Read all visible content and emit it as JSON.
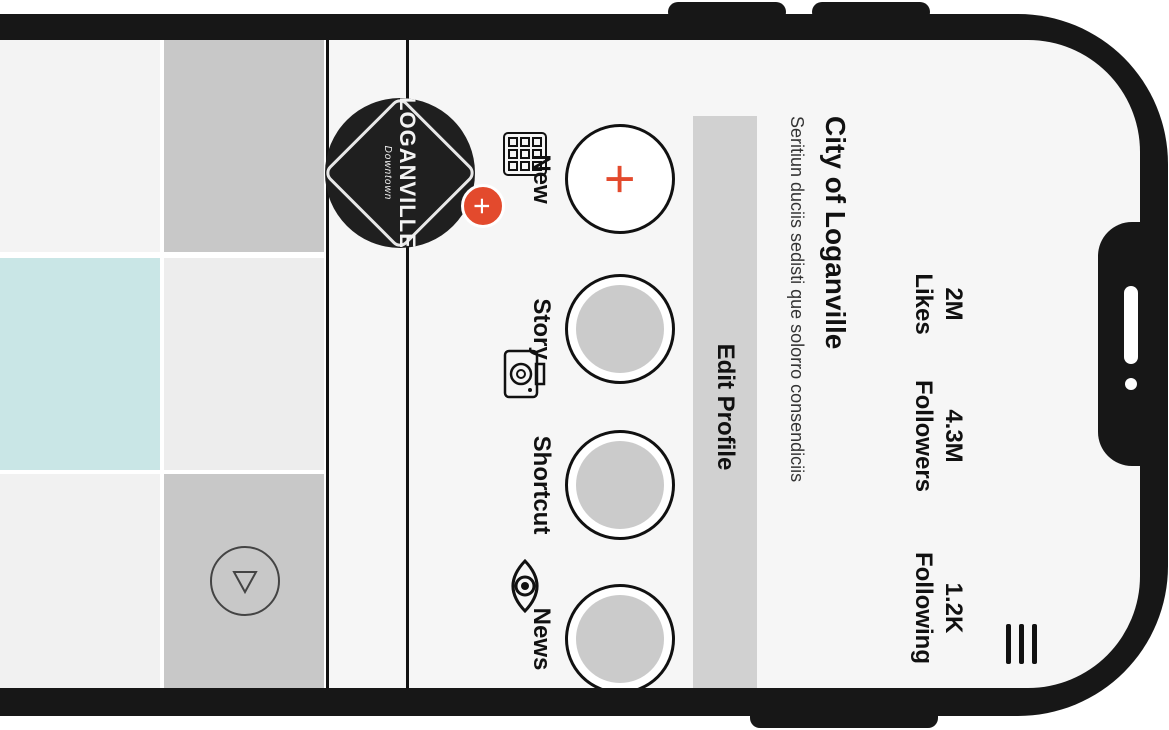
{
  "profile": {
    "name": "City of Loganville",
    "bio": "Seritiun duciis sedisti que solorro consendiciis",
    "avatar_logo_text": "LOGANVILLE",
    "avatar_logo_subtext": "Downtown",
    "add_badge": "+"
  },
  "stats": [
    {
      "value": "2M",
      "label": "Likes"
    },
    {
      "value": "4.3M",
      "label": "Followers"
    },
    {
      "value": "1.2K",
      "label": "Following"
    }
  ],
  "edit_profile_label": "Edit Profile",
  "highlights": [
    {
      "label": "New",
      "type": "add",
      "glyph": "+"
    },
    {
      "label": "Story",
      "type": "circle"
    },
    {
      "label": "Shortcut",
      "type": "circle"
    },
    {
      "label": "News",
      "type": "circle"
    }
  ],
  "tabs": [
    {
      "icon": "grid-icon"
    },
    {
      "icon": "camera-icon"
    },
    {
      "icon": "eye-icon"
    }
  ],
  "colors": {
    "accent": "#e34a2d",
    "frame": "#171717",
    "placeholder_gray": "#cbcbcb",
    "tile_teal": "#c9e6e6"
  }
}
